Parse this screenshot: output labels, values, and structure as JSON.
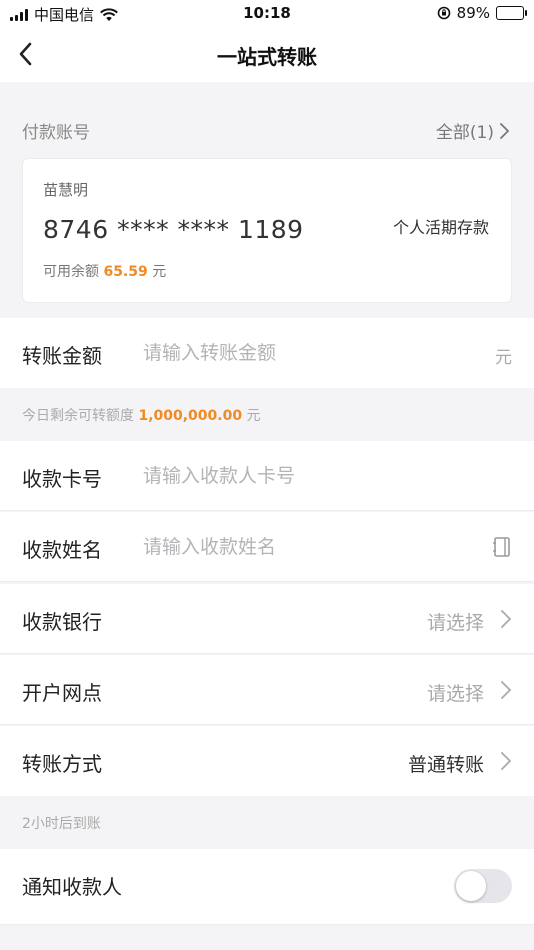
{
  "status_bar": {
    "carrier": "中国电信",
    "time": "10:18",
    "battery": "89%",
    "battery_level": 0.89,
    "icons": [
      "signal-icon",
      "wifi-icon",
      "rotation-lock-icon",
      "battery-icon"
    ]
  },
  "nav": {
    "title": "一站式转账",
    "back_icon": "chevron-left-icon"
  },
  "payer": {
    "label": "付款账号",
    "all_label": "全部(1)",
    "card": {
      "name": "苗慧明",
      "number": "8746 **** **** 1189",
      "type": "个人活期存款",
      "balance_label": "可用余额",
      "balance": "65.59",
      "currency": "元"
    }
  },
  "amount": {
    "label": "转账金额",
    "placeholder": "请输入转账金额",
    "unit": "元"
  },
  "limit_hint": {
    "prefix": "今日剩余可转额度",
    "amount": "1,000,000.00",
    "suffix": "元"
  },
  "payee_card": {
    "label": "收款卡号",
    "placeholder": "请输入收款人卡号"
  },
  "payee_name": {
    "label": "收款姓名",
    "placeholder": "请输入收款姓名",
    "icon": "address-book-icon"
  },
  "payee_bank": {
    "label": "收款银行",
    "value": "请选择"
  },
  "branch": {
    "label": "开户网点",
    "value": "请选择"
  },
  "method": {
    "label": "转账方式",
    "value": "普通转账"
  },
  "arrival_hint": "2小时后到账",
  "notify": {
    "label": "通知收款人",
    "enabled": false
  },
  "colors": {
    "accent_orange": "#f08a24",
    "background": "#f4f4f6",
    "placeholder": "#b4b4b8"
  }
}
